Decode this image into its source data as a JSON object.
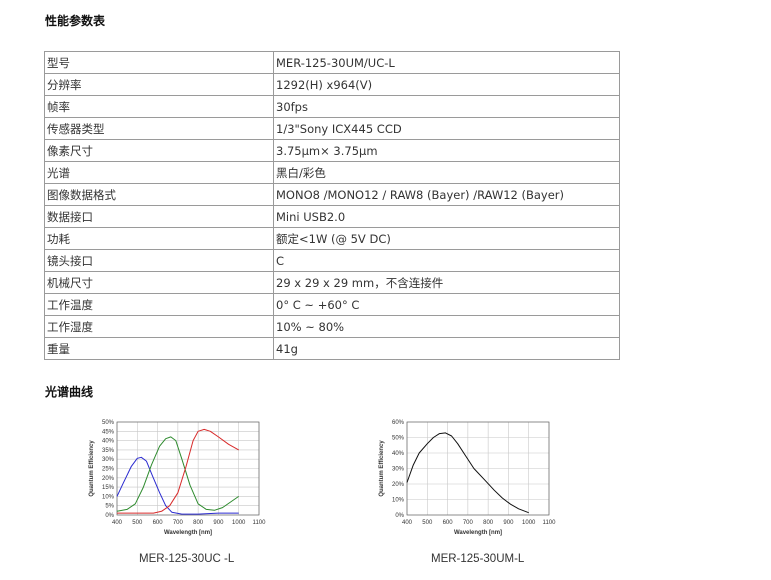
{
  "section_specs_title": "性能参数表",
  "specs": [
    {
      "k": "型号",
      "v": "MER-125-30UM/UC-L"
    },
    {
      "k": "分辨率",
      "v": "1292(H) x964(V)"
    },
    {
      "k": "帧率",
      "v": "30fps"
    },
    {
      "k": "传感器类型",
      "v": "1/3\"Sony ICX445 CCD"
    },
    {
      "k": "像素尺寸",
      "v": "3.75μm× 3.75μm"
    },
    {
      "k": "光谱",
      "v": "黑白/彩色"
    },
    {
      "k": "图像数据格式",
      "v": "MONO8 /MONO12 / RAW8 (Bayer) /RAW12 (Bayer)"
    },
    {
      "k": "数据接口",
      "v": "Mini USB2.0"
    },
    {
      "k": "功耗",
      "v": "额定<1W (@ 5V DC)"
    },
    {
      "k": "镜头接口",
      "v": "C"
    },
    {
      "k": "机械尺寸",
      "v": "29 x 29 x 29 mm，不含连接件"
    },
    {
      "k": "工作温度",
      "v": "0° C ~ +60° C"
    },
    {
      "k": "工作湿度",
      "v": "10% ~ 80%"
    },
    {
      "k": "重量",
      "v": "41g"
    }
  ],
  "section_spectrum_title": "光谱曲线",
  "chart_data": [
    {
      "type": "line",
      "caption": "MER-125-30UC -L",
      "xlabel": "Wavelength [nm]",
      "ylabel": "Quantum Efficiency",
      "xlim": [
        400,
        1100
      ],
      "ylim": [
        0,
        50
      ],
      "xticks": [
        "400",
        "500",
        "600",
        "700",
        "800",
        "900",
        "1000",
        "1100"
      ],
      "yticks": [
        "0%",
        "5%",
        "10%",
        "15%",
        "20%",
        "25%",
        "30%",
        "35%",
        "40%",
        "45%",
        "50%"
      ],
      "grid": true,
      "series": [
        {
          "color": "#2a2ad0",
          "points": [
            [
              400,
              10
            ],
            [
              430,
              17
            ],
            [
              470,
              26
            ],
            [
              500,
              30.5
            ],
            [
              520,
              31
            ],
            [
              545,
              29
            ],
            [
              575,
              21
            ],
            [
              610,
              12
            ],
            [
              640,
              5
            ],
            [
              670,
              1.5
            ],
            [
              720,
              0.5
            ],
            [
              800,
              0.5
            ],
            [
              900,
              1
            ],
            [
              1000,
              1
            ]
          ]
        },
        {
          "color": "#2e8b2e",
          "points": [
            [
              400,
              2
            ],
            [
              450,
              3
            ],
            [
              490,
              6
            ],
            [
              530,
              15
            ],
            [
              570,
              27
            ],
            [
              610,
              37
            ],
            [
              640,
              41
            ],
            [
              665,
              42
            ],
            [
              690,
              40
            ],
            [
              720,
              30
            ],
            [
              760,
              16
            ],
            [
              800,
              6
            ],
            [
              840,
              3
            ],
            [
              880,
              2.5
            ],
            [
              920,
              4
            ],
            [
              960,
              7
            ],
            [
              1000,
              10
            ]
          ]
        },
        {
          "color": "#d82a2a",
          "points": [
            [
              400,
              1
            ],
            [
              500,
              1
            ],
            [
              580,
              1
            ],
            [
              620,
              2
            ],
            [
              660,
              5
            ],
            [
              700,
              12
            ],
            [
              740,
              26
            ],
            [
              775,
              40
            ],
            [
              800,
              45
            ],
            [
              830,
              46
            ],
            [
              860,
              45
            ],
            [
              900,
              42
            ],
            [
              950,
              38
            ],
            [
              1000,
              35
            ]
          ]
        }
      ]
    },
    {
      "type": "line",
      "caption": "MER-125-30UM-L",
      "xlabel": "Wavelength [nm]",
      "ylabel": "Quantum Efficiency",
      "xlim": [
        400,
        1100
      ],
      "ylim": [
        0,
        60
      ],
      "xticks": [
        "400",
        "500",
        "600",
        "700",
        "800",
        "900",
        "1000",
        "1100"
      ],
      "yticks": [
        "0%",
        "10%",
        "20%",
        "30%",
        "40%",
        "50%",
        "60%"
      ],
      "grid": true,
      "series": [
        {
          "color": "#111111",
          "points": [
            [
              400,
              21
            ],
            [
              430,
              32
            ],
            [
              460,
              40
            ],
            [
              500,
              46
            ],
            [
              530,
              50
            ],
            [
              560,
              52.5
            ],
            [
              590,
              53
            ],
            [
              620,
              51
            ],
            [
              650,
              46
            ],
            [
              690,
              38
            ],
            [
              730,
              30
            ],
            [
              780,
              23
            ],
            [
              830,
              16
            ],
            [
              870,
              11
            ],
            [
              910,
              7
            ],
            [
              950,
              4
            ],
            [
              1000,
              1.5
            ]
          ]
        }
      ]
    }
  ]
}
